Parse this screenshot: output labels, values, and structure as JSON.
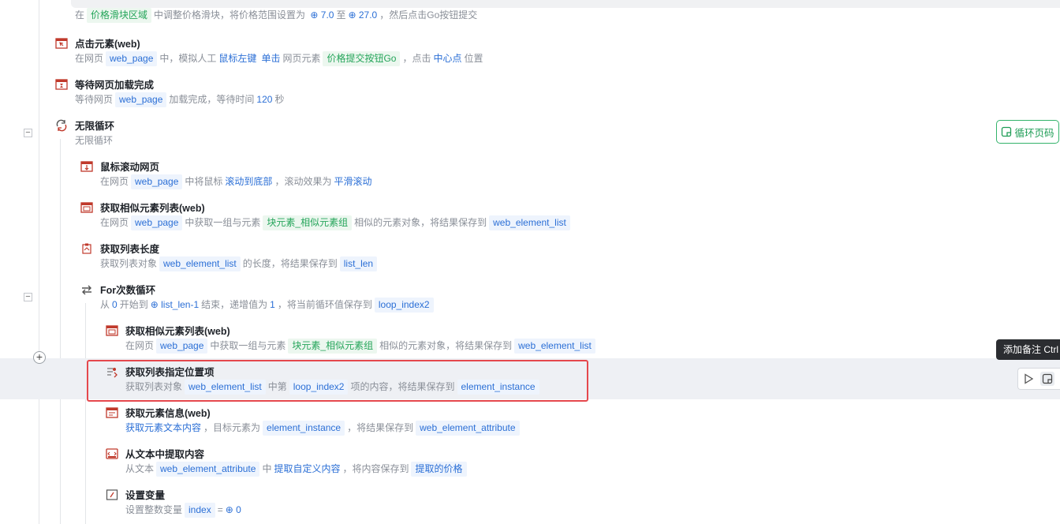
{
  "top_desc": {
    "p1": "在",
    "t1": "价格滑块区域",
    "p2": "中调整价格滑块，将价格范围设置为",
    "v1": "7.0",
    "p3": "至",
    "v2": "27.0",
    "p4": "，然后点击Go按钮提交"
  },
  "steps": [
    {
      "title": "点击元素(web)",
      "d1": "在网页",
      "t1": "web_page",
      "d2": "中，模拟人工",
      "k1": "鼠标左键",
      "k2": "单击",
      "d3": "网页元素",
      "t2": "价格提交按钮Go",
      "d4": "，点击",
      "k3": "中心点",
      "d5": "位置"
    },
    {
      "title": "等待网页加载完成",
      "d1": "等待网页",
      "t1": "web_page",
      "d2": "加载完成，等待时间",
      "k1": "120",
      "d3": "秒"
    },
    {
      "title": "无限循环",
      "d1": "无限循环"
    },
    {
      "title": "鼠标滚动网页",
      "d1": "在网页",
      "t1": "web_page",
      "d2": "中将鼠标",
      "k1": "滚动到底部",
      "d3": "，滚动效果为",
      "k2": "平滑滚动"
    },
    {
      "title": "获取相似元素列表(web)",
      "d1": "在网页",
      "t1": "web_page",
      "d2": "中获取一组与元素",
      "t2": "块元素_相似元素组",
      "d3": "相似的元素对象，将结果保存到",
      "t3": "web_element_list"
    },
    {
      "title": "获取列表长度",
      "d1": "获取列表对象",
      "t1": "web_element_list",
      "d2": "的长度，将结果保存到",
      "t2": "list_len"
    },
    {
      "title": "For次数循环",
      "d1": "从",
      "k1": "0",
      "d2": "开始到",
      "k2": "list_len-1",
      "d3": "结束，递增值为",
      "k3": "1",
      "d4": "，将当前循环值保存到",
      "t1": "loop_index2"
    },
    {
      "title": "获取相似元素列表(web)",
      "d1": "在网页",
      "t1": "web_page",
      "d2": "中获取一组与元素",
      "t2": "块元素_相似元素组",
      "d3": "相似的元素对象，将结果保存到",
      "t3": "web_element_list"
    },
    {
      "title": "获取列表指定位置项",
      "d1": "获取列表对象",
      "t1": "web_element_list",
      "d2": "中第",
      "t2": "loop_index2",
      "d3": "项的内容，将结果保存到",
      "t3": "element_instance"
    },
    {
      "title": "获取元素信息(web)",
      "k1": "获取元素文本内容",
      "d1": "，目标元素为",
      "t1": "element_instance",
      "d2": "，将结果保存到",
      "t2": "web_element_attribute"
    },
    {
      "title": "从文本中提取内容",
      "d1": "从文本",
      "t1": "web_element_attribute",
      "d2": "中",
      "k1": "提取自定义内容",
      "d3": "，将内容保存到",
      "t2": "提取的价格"
    },
    {
      "title": "设置变量",
      "d1": "设置整数变量",
      "t1": "index",
      "d2": "=",
      "k1": "0"
    }
  ],
  "loop_button": {
    "label": "循环页码"
  },
  "tooltip": {
    "text": "添加备注 Ctrl"
  },
  "collapse_symbol": "−",
  "add_symbol": "+",
  "colors": {
    "accent_blue": "#2b6fd6",
    "accent_green": "#25a55a",
    "selection_red": "#e5484d",
    "loop_green": "#33b36b"
  },
  "icons": [
    "click-icon",
    "wait-icon",
    "loop-icon",
    "scroll-icon",
    "element-list-icon",
    "list-length-icon",
    "for-loop-icon",
    "list-item-icon",
    "element-info-icon",
    "text-extract-icon",
    "variable-icon",
    "play-icon",
    "note-icon"
  ]
}
